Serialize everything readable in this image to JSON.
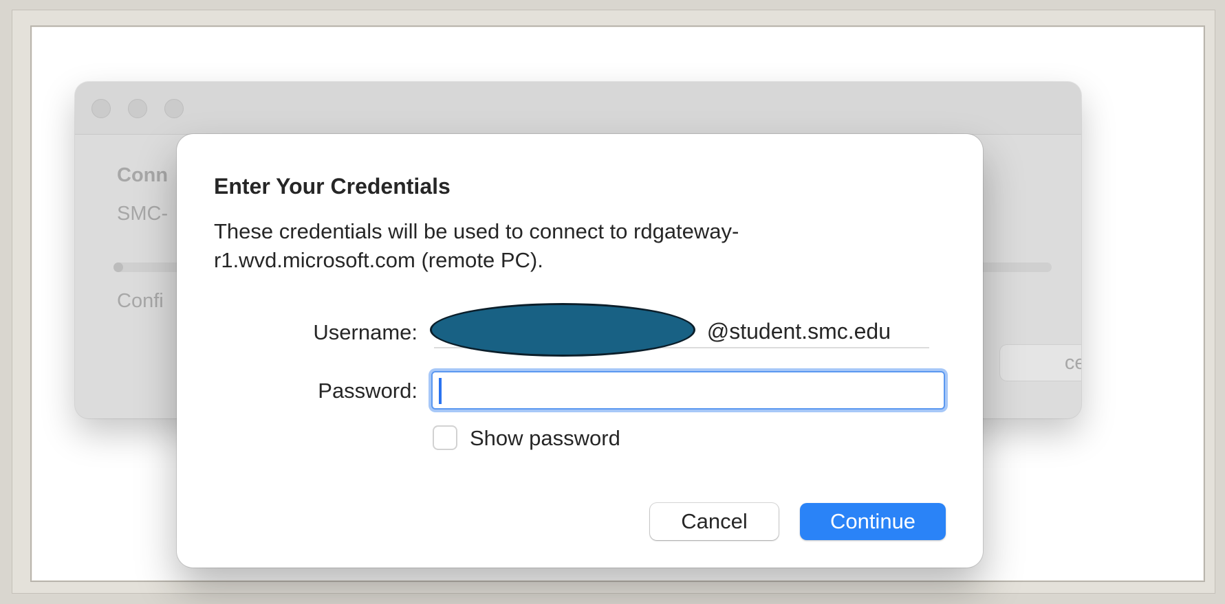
{
  "background_window": {
    "heading": "Conn",
    "subtitle": "SMC-",
    "progress_fraction": 0.008,
    "status": "Confi",
    "cancel_label": "cel"
  },
  "dialog": {
    "title": "Enter Your Credentials",
    "message": "These credentials will be used to connect to rdgateway-r1.wvd.microsoft.com (remote PC).",
    "username_label": "Username:",
    "username_value": "@student.smc.edu",
    "password_label": "Password:",
    "password_value": "",
    "show_password_label": "Show password",
    "show_password_checked": false,
    "cancel_label": "Cancel",
    "continue_label": "Continue"
  },
  "colors": {
    "accent": "#2a83f7",
    "focus_ring": "#a7c8f8",
    "redaction": "#186184"
  }
}
